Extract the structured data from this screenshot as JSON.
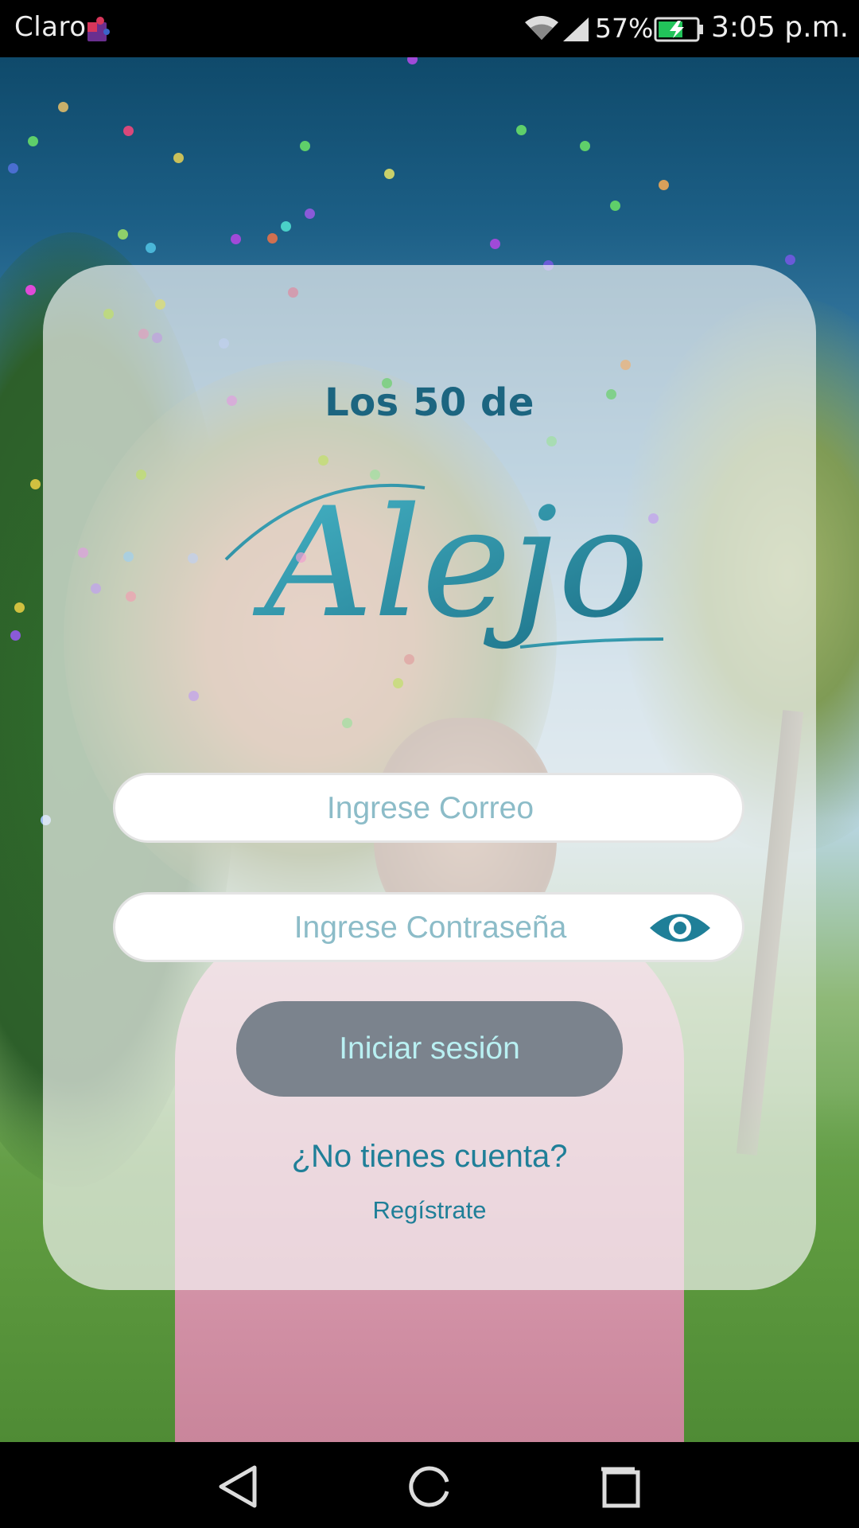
{
  "status_bar": {
    "carrier": "Claro",
    "battery_percent": "57%",
    "time": "3:05 p.m.",
    "icons": [
      "puzzle-icon",
      "wifi-icon",
      "signal-icon",
      "battery-charging-icon"
    ]
  },
  "logo": {
    "top_text": "Los 50 de",
    "script_text": "Alejo"
  },
  "form": {
    "email_placeholder": "Ingrese Correo",
    "email_value": "",
    "password_placeholder": "Ingrese Contraseña",
    "password_value": "",
    "login_label": "Iniciar sesión",
    "no_account_text": "¿No tienes cuenta?",
    "register_label": "Regístrate"
  },
  "nav_bar": {
    "buttons": [
      "back-icon",
      "home-icon",
      "recent-apps-icon"
    ]
  },
  "colors": {
    "accent": "#1f7f98",
    "logo_teal": "#1c6580",
    "button_bg": "#7b838d",
    "button_text": "#b9f0f2",
    "card_bg": "rgba(244,244,244,0.68)"
  }
}
